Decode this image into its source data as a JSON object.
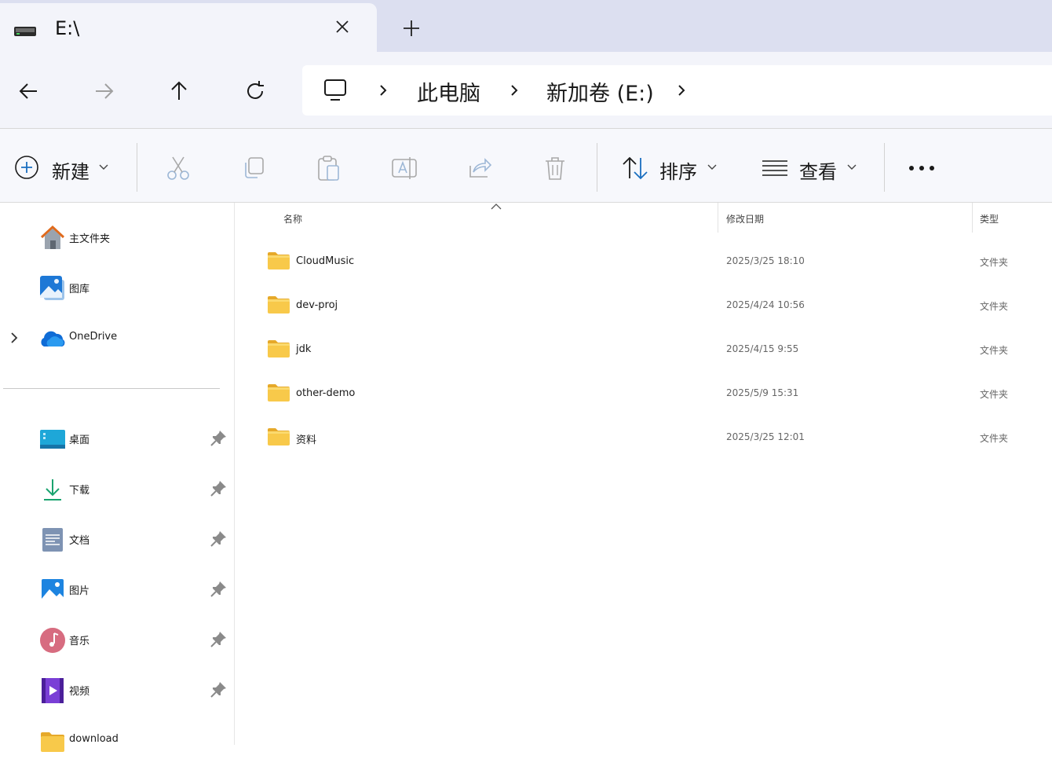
{
  "tab": {
    "title": "E:\\",
    "icon": "drive-icon",
    "close_icon": "close-icon",
    "new_tab_icon": "plus-icon"
  },
  "nav": {
    "back_icon": "arrow-left-icon",
    "forward_icon": "arrow-right-icon",
    "up_icon": "arrow-up-icon",
    "refresh_icon": "refresh-icon"
  },
  "address": {
    "root_icon": "monitor-icon",
    "crumbs": [
      "此电脑",
      "新加卷 (E:)"
    ]
  },
  "toolbar": {
    "new_label": "新建",
    "sort_label": "排序",
    "view_label": "查看",
    "icons": [
      "cut-icon",
      "copy-icon",
      "paste-icon",
      "rename-icon",
      "share-icon",
      "delete-icon"
    ]
  },
  "sidebar": {
    "top_items": [
      {
        "label": "主文件夹",
        "icon": "home-icon"
      },
      {
        "label": "图库",
        "icon": "gallery-icon"
      },
      {
        "label": "OneDrive",
        "icon": "onedrive-icon"
      }
    ],
    "quick_access": [
      {
        "label": "桌面",
        "icon": "desktop-icon",
        "pinned": true
      },
      {
        "label": "下载",
        "icon": "download-icon",
        "pinned": true
      },
      {
        "label": "文档",
        "icon": "documents-icon",
        "pinned": true
      },
      {
        "label": "图片",
        "icon": "pictures-icon",
        "pinned": true
      },
      {
        "label": "音乐",
        "icon": "music-icon",
        "pinned": true
      },
      {
        "label": "视频",
        "icon": "videos-icon",
        "pinned": true
      },
      {
        "label": "download",
        "icon": "folder-icon",
        "pinned": false
      }
    ]
  },
  "list": {
    "columns": {
      "name": "名称",
      "date": "修改日期",
      "type": "类型"
    },
    "rows": [
      {
        "name": "CloudMusic",
        "date": "2025/3/25 18:10",
        "type": "文件夹"
      },
      {
        "name": "dev-proj",
        "date": "2025/4/24 10:56",
        "type": "文件夹"
      },
      {
        "name": "jdk",
        "date": "2025/4/15 9:55",
        "type": "文件夹"
      },
      {
        "name": "other-demo",
        "date": "2025/5/9 15:31",
        "type": "文件夹"
      },
      {
        "name": "资料",
        "date": "2025/3/25 12:01",
        "type": "文件夹"
      }
    ]
  },
  "colors": {
    "tabstrip": "#dcdff0",
    "chrome": "#f3f4fa",
    "accent": "#0067c0",
    "folder": "#f8c94a"
  }
}
